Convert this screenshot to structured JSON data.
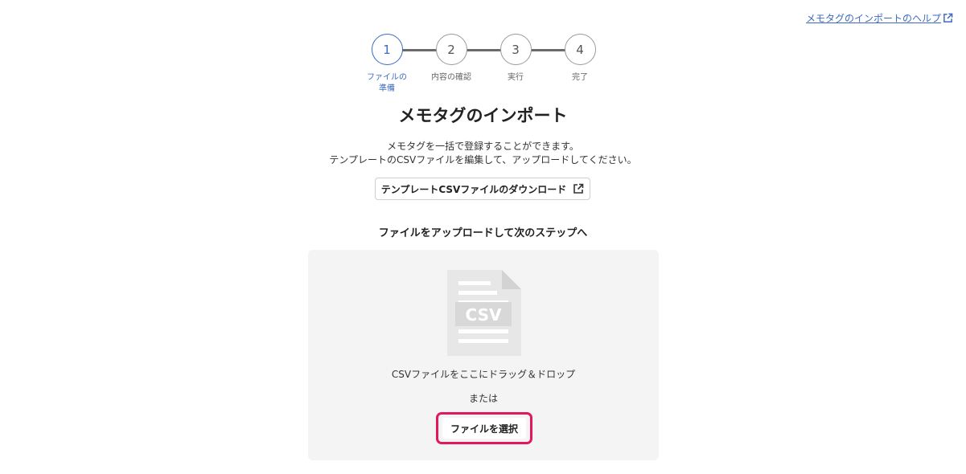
{
  "help_link": {
    "label": "メモタグのインポートのヘルプ",
    "icon": "external-link-icon"
  },
  "stepper": {
    "steps": [
      {
        "number": "1",
        "label": "ファイルの準備",
        "active": true
      },
      {
        "number": "2",
        "label": "内容の確認",
        "active": false
      },
      {
        "number": "3",
        "label": "実行",
        "active": false
      },
      {
        "number": "4",
        "label": "完了",
        "active": false
      }
    ]
  },
  "page": {
    "title": "メモタグのインポート",
    "desc_line1": "メモタグを一括で登録することができます。",
    "desc_line2": "テンプレートのCSVファイルを編集して、アップロードしてください。",
    "template_button": "テンプレートCSVファイルのダウンロード",
    "section_heading": "ファイルをアップロードして次のステップへ"
  },
  "dropzone": {
    "icon_text": "CSV",
    "drop_text": "CSVファイルをここにドラッグ＆ドロップ",
    "or_text": "または",
    "choose_button": "ファイルを選択"
  },
  "colors": {
    "accent": "#3d6ac2",
    "highlight": "#e3175f",
    "dropzone_bg": "#f5f4f4"
  }
}
